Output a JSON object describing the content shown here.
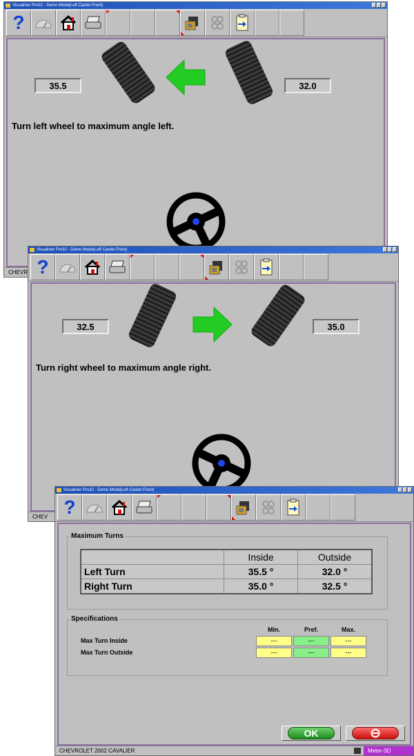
{
  "windows": [
    {
      "title": "Visualiner Pro32 - Demo Mode(Left Caster-Front)",
      "left_reading": "35.5",
      "right_reading": "32.0",
      "instruction": "Turn left wheel to maximum angle left.",
      "arrow_direction": "left",
      "status_text": "CHEVR"
    },
    {
      "title": "Visualiner Pro32 - Demo Mode(Left Caster-Front)",
      "left_reading": "32.5",
      "right_reading": "35.0",
      "instruction": "Turn right wheel to maximum angle right.",
      "arrow_direction": "right",
      "status_text": "CHEV"
    },
    {
      "title": "Visualiner Pro32 - Demo Mode(Left Caster-Front)",
      "max_turns": {
        "title": "Maximum Turns",
        "columns": [
          "Inside",
          "Outside"
        ],
        "rows": [
          {
            "label": "Left Turn",
            "inside": "35.5 °",
            "outside": "32.0 °"
          },
          {
            "label": "Right Turn",
            "inside": "35.0 °",
            "outside": "32.5 °"
          }
        ]
      },
      "specifications": {
        "title": "Specifications",
        "columns": [
          "Min.",
          "Pref.",
          "Max."
        ],
        "rows": [
          {
            "label": "Max Turn Inside",
            "min": "---",
            "pref": "---",
            "max": "---"
          },
          {
            "label": "Max Turn Outside",
            "min": "---",
            "pref": "---",
            "max": "---"
          }
        ]
      },
      "ok_label": "OK",
      "status_text": "CHEVROLET  2002  CAVALIER",
      "status_right": "Meter-3D"
    }
  ],
  "toolbar_icons": [
    "help-icon",
    "gauge-icon",
    "home-icon",
    "printer-icon",
    "blank",
    "blank",
    "sensor-icon",
    "wheels-icon",
    "clipboard-icon",
    "blank",
    "blank"
  ],
  "colors": {
    "window_bg": "#c0c0c0",
    "titlebar": "#1d4fb8",
    "arrow_green": "#22cc22",
    "accent_red": "#e01010",
    "spec_yellow": "#ffff88",
    "spec_green": "#88ee88",
    "ok_green": "#1d8a1d",
    "meter_purple": "#b030d0"
  }
}
